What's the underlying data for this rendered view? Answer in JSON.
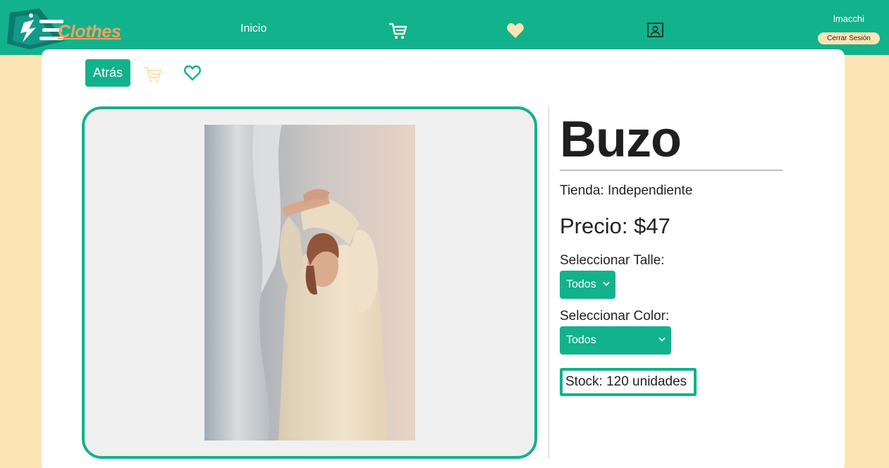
{
  "brand": {
    "name": "Clothes"
  },
  "nav": {
    "home_label": "Inicio",
    "icons": [
      "cart-icon",
      "heart-icon",
      "user-icon"
    ],
    "username": "lmacchi",
    "logout_label": "Cerrar Sesión"
  },
  "actions": {
    "back_label": "Atrás",
    "icons": [
      "cart-icon",
      "heart-outline-icon"
    ]
  },
  "product": {
    "title": "Buzo",
    "store_line": "Tienda: Independiente",
    "price_line": "Precio: $47",
    "size_label": "Seleccionar Talle:",
    "size_value": "Todos",
    "color_label": "Seleccionar Color:",
    "color_value": "Todos",
    "stock_line": "Stock: 120 unidades"
  },
  "colors": {
    "primary": "#12b28c",
    "background": "#fde4b4",
    "accent": "#f4a062",
    "image_panel": "#f0f0f0"
  }
}
